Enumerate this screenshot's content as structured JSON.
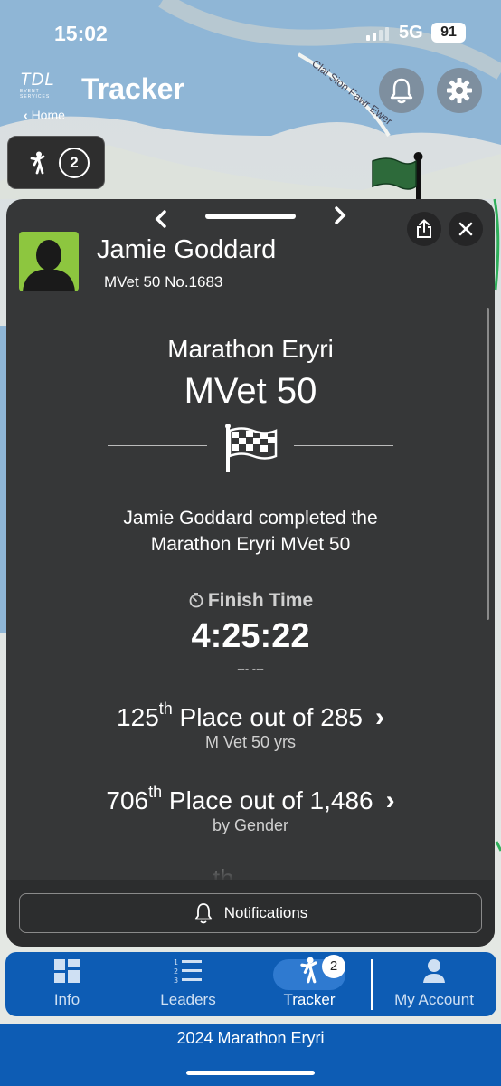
{
  "status_bar": {
    "time": "15:02",
    "network": "5G",
    "battery": "91"
  },
  "header": {
    "logo_text": "TDL",
    "logo_sub": "EVENT SERVICES",
    "title": "Tracker",
    "back_label": "Home",
    "bell_icon": "bell-icon",
    "settings_icon": "gear-icon"
  },
  "map": {
    "road_label": "Clai Sion Fawr Ewer"
  },
  "tracker_chip": {
    "icon": "runner-icon",
    "count": "2"
  },
  "athlete": {
    "name": "Jamie Goddard",
    "subtitle": "MVet 50 No.1683",
    "event": "Marathon Eryri",
    "category": "MVet 50",
    "completed_line1": "Jamie Goddard completed the",
    "completed_line2": "Marathon Eryri MVet 50",
    "finish_label": "Finish Time",
    "finish_time": "4:25:22",
    "dashes": "--- ---"
  },
  "placings": [
    {
      "pos": "125",
      "suffix": "th",
      "text": " Place out of 285",
      "sub": "M Vet 50 yrs"
    },
    {
      "pos": "706",
      "suffix": "th",
      "text": " Place out of 1,486",
      "sub": "by Gender"
    },
    {
      "pos": "",
      "suffix": "th",
      "text": "",
      "sub": ""
    }
  ],
  "card_actions": {
    "share_icon": "share-icon",
    "close_icon": "close-icon",
    "notifications_label": "Notifications"
  },
  "tabs": [
    {
      "label": "Info",
      "icon": "dashboard-icon"
    },
    {
      "label": "Leaders",
      "icon": "list-numbered-icon"
    },
    {
      "label": "Tracker",
      "icon": "runner-icon",
      "badge": "2"
    },
    {
      "label": "My Account",
      "icon": "person-icon"
    }
  ],
  "footer_title": "2024 Marathon Eryri",
  "colors": {
    "tab_blue": "#0d5cb4",
    "card_bg": "#363738",
    "avatar_green": "#8dc63f",
    "flag_green": "#2d6a3a"
  }
}
